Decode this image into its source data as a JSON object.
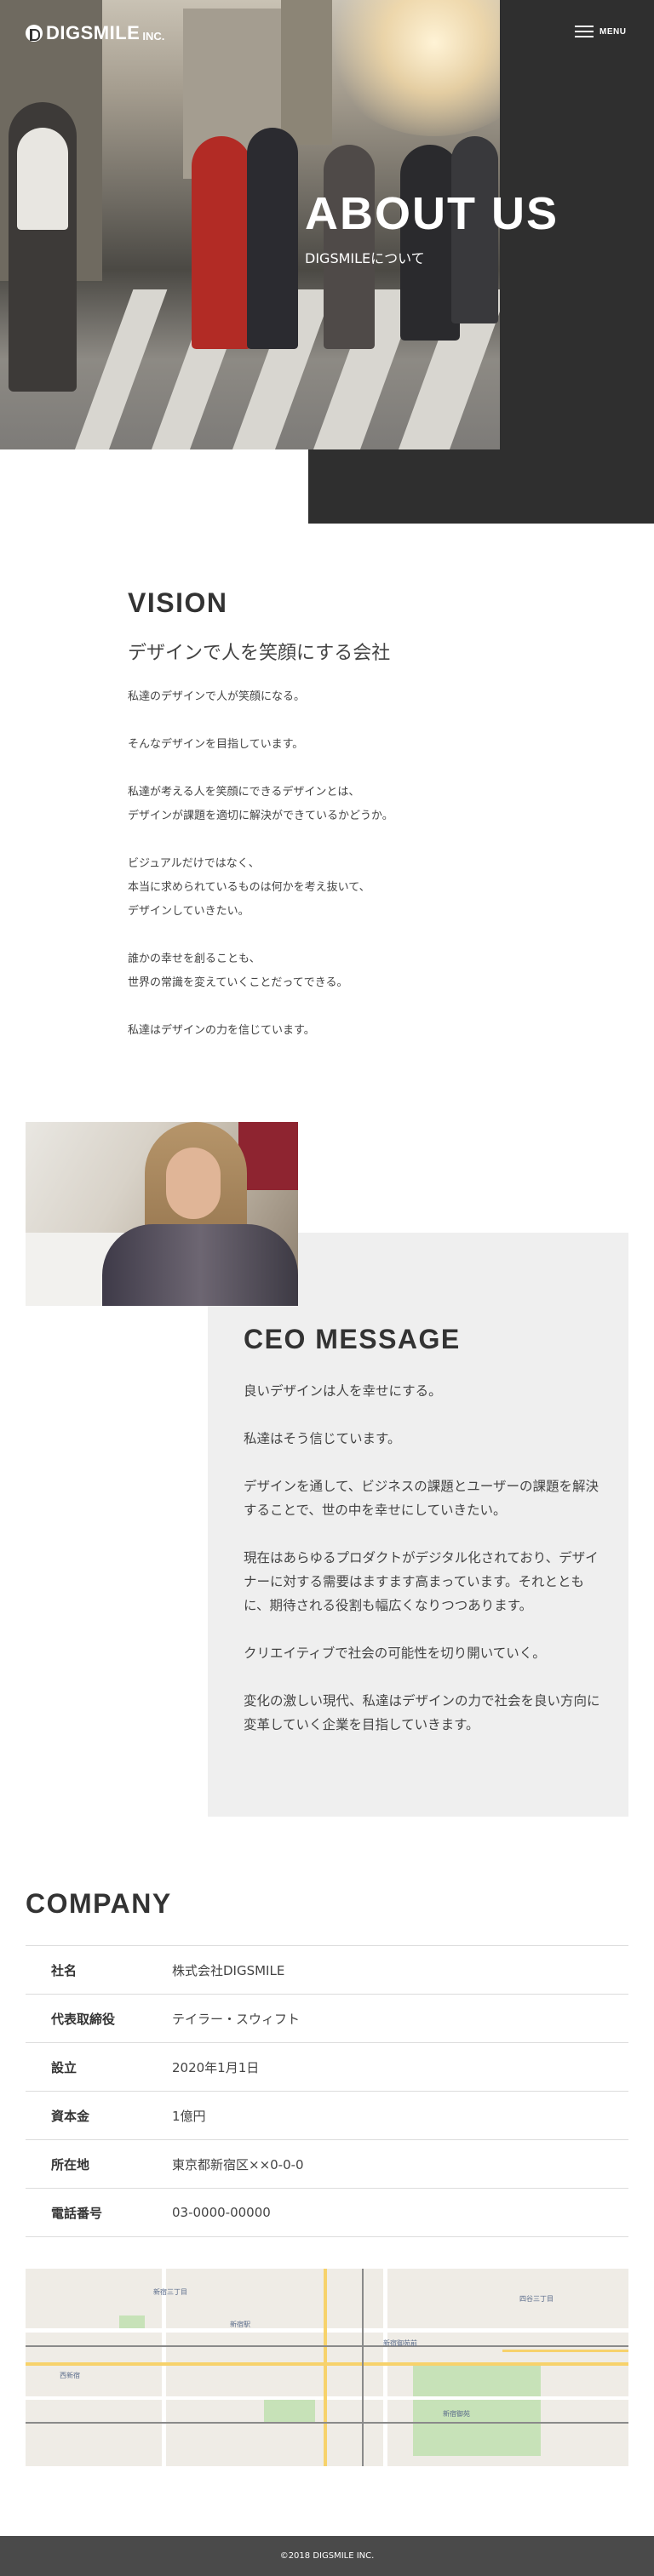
{
  "header": {
    "logo_text": "DIGSMILE",
    "logo_suffix": "INC.",
    "menu_label": "MENU"
  },
  "hero": {
    "title": "ABOUT US",
    "subtitle": "DIGSMILEについて"
  },
  "vision": {
    "title": "VISION",
    "lead": "デザインで人を笑顔にする会社",
    "paragraphs": [
      "私達のデザインで人が笑顔になる。",
      "そんなデザインを目指しています。",
      "私達が考える人を笑顔にできるデザインとは、\nデザインが課題を適切に解決ができているかどうか。",
      "ビジュアルだけではなく、\n本当に求められているものは何かを考え抜いて、\nデザインしていきたい。",
      "誰かの幸せを創ることも、\n世界の常識を変えていくことだってできる。",
      "私達はデザインの力を信じています。"
    ]
  },
  "ceo": {
    "title": "CEO MESSAGE",
    "paragraphs": [
      "良いデザインは人を幸せにする。",
      "私達はそう信じています。",
      "デザインを通して、ビジネスの課題とユーザーの課題を解決することで、世の中を幸せにしていきたい。",
      "現在はあらゆるプロダクトがデジタル化されており、デザイナーに対する需要はますます高まっています。それとともに、期待される役割も幅広くなりつつあります。",
      "クリエイティブで社会の可能性を切り開いていく。",
      "変化の激しい現代、私達はデザインの力で社会を良い方向に変革していく企業を目指していきます。"
    ]
  },
  "company": {
    "title": "COMPANY",
    "rows": [
      {
        "label": "社名",
        "value": "株式会社DIGSMILE"
      },
      {
        "label": "代表取締役",
        "value": "テイラー・スウィフト"
      },
      {
        "label": "設立",
        "value": "2020年1月1日"
      },
      {
        "label": "資本金",
        "value": "1億円"
      },
      {
        "label": "所在地",
        "value": "東京都新宿区××0-0-0"
      },
      {
        "label": "電話番号",
        "value": "03-0000-00000"
      }
    ]
  },
  "footer": {
    "copyright": "©2018 DIGSMILE INC."
  }
}
